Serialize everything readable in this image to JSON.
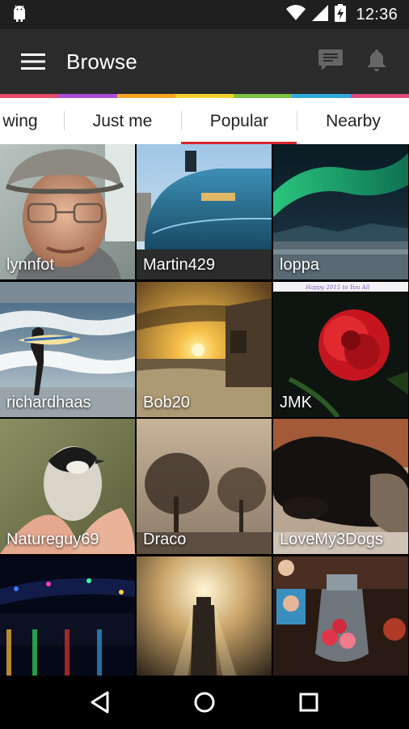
{
  "status_bar": {
    "time": "12:36",
    "icons": [
      "android-icon",
      "wifi-icon",
      "signal-icon",
      "battery-charging-icon"
    ]
  },
  "app_bar": {
    "title": "Browse",
    "actions": [
      "messages-icon",
      "notifications-icon"
    ]
  },
  "accent_stripe": [
    "#e84a6a",
    "#a84fd4",
    "#f6a623",
    "#f2d130",
    "#7bc043",
    "#2fa8e0",
    "#e04a78"
  ],
  "tabs": [
    {
      "label": "wing",
      "selected": false
    },
    {
      "label": "Just me",
      "selected": false
    },
    {
      "label": "Popular",
      "selected": true
    },
    {
      "label": "Nearby",
      "selected": false
    }
  ],
  "tab_indicator_color": "#d6262e",
  "photos": [
    {
      "user": "lynnfot"
    },
    {
      "user": "Martin429"
    },
    {
      "user": "loppa"
    },
    {
      "user": "richardhaas"
    },
    {
      "user": "Bob20"
    },
    {
      "user": "JMK"
    },
    {
      "user": "Natureguy69"
    },
    {
      "user": "Draco"
    },
    {
      "user": "LoveMy3Dogs"
    },
    {
      "user": ""
    },
    {
      "user": ""
    },
    {
      "user": ""
    }
  ],
  "nav_bar": [
    "back-icon",
    "home-icon",
    "recents-icon"
  ]
}
